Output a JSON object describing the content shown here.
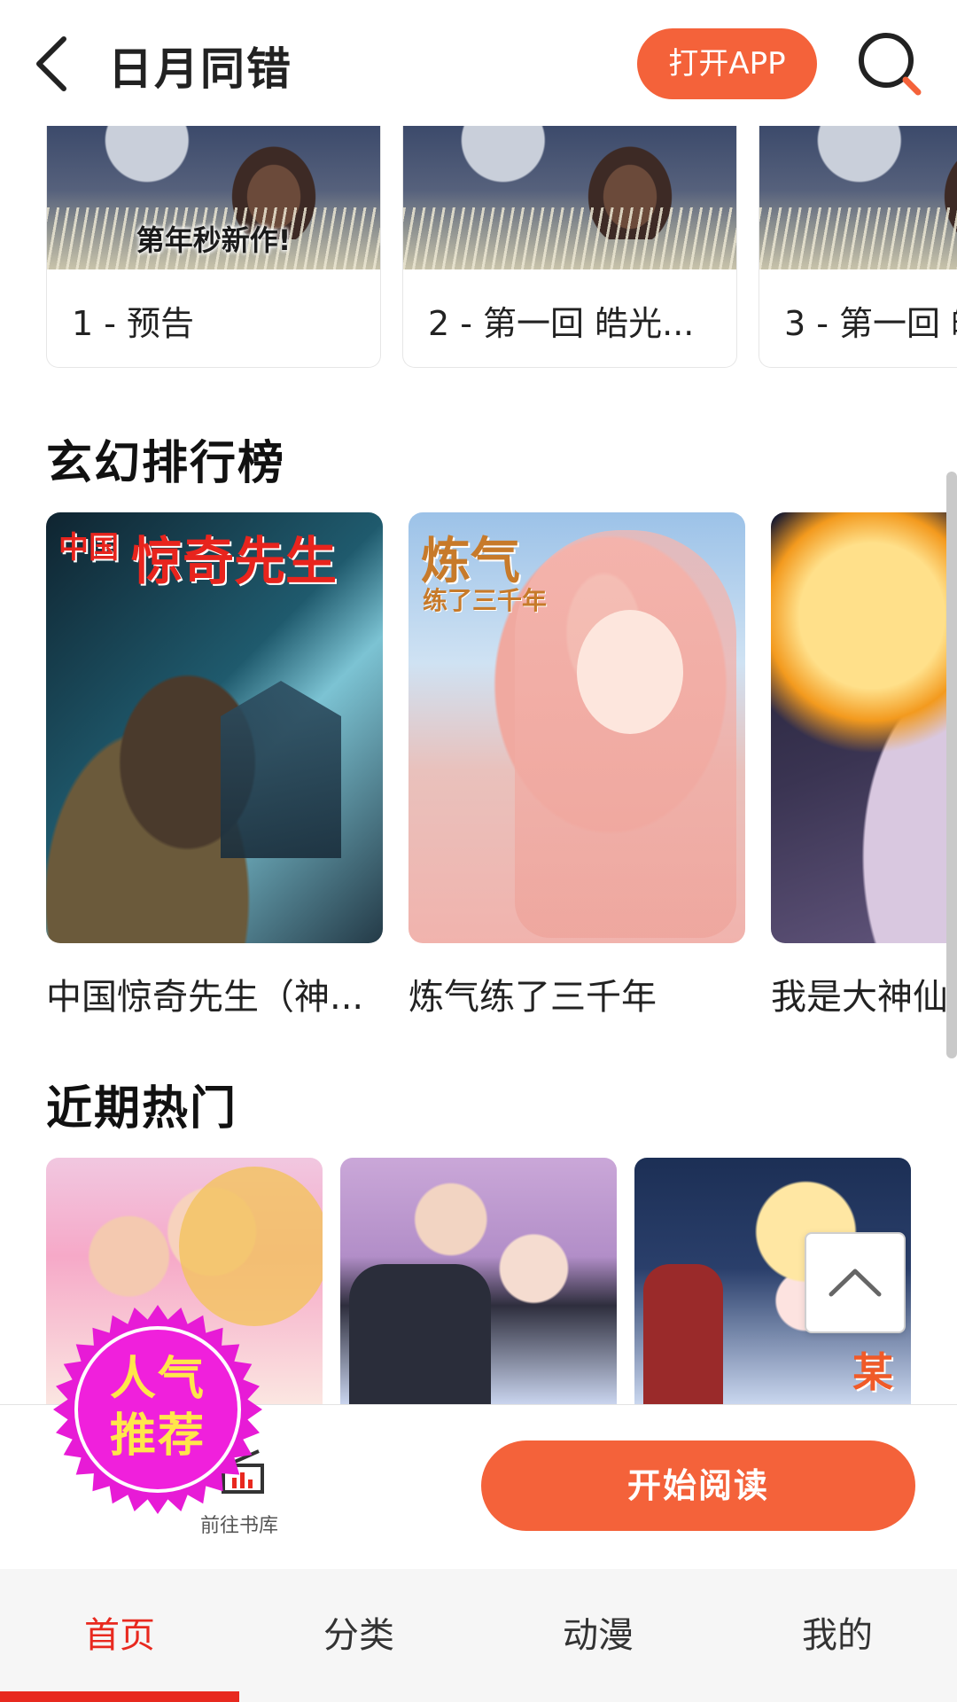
{
  "header": {
    "title": "日月同错",
    "open_app": "打开APP"
  },
  "episodes": [
    {
      "label": "1 - 预告",
      "caption": "第年秒新作!"
    },
    {
      "label": "2 - 第一回 皓光..."
    },
    {
      "label": "3 - 第一回 皓"
    }
  ],
  "ranking": {
    "title": "玄幻排行榜",
    "items": [
      {
        "name": "中国惊奇先生（神...",
        "cover_big": "惊奇先生",
        "cover_small": "中国"
      },
      {
        "name": "炼气练了三千年",
        "cover_big": "炼气",
        "cover_small": "练了三千年"
      },
      {
        "name": "我是大神仙"
      }
    ]
  },
  "hot": {
    "title": "近期热门",
    "cover3_char": "某"
  },
  "badge": {
    "line1": "人气",
    "line2": "推荐",
    "color": "#e71bd6"
  },
  "action_bar": {
    "library": "前往书库",
    "start_reading": "开始阅读"
  },
  "tabs": [
    {
      "label": "首页",
      "active": true
    },
    {
      "label": "分类"
    },
    {
      "label": "动漫"
    },
    {
      "label": "我的"
    }
  ],
  "colors": {
    "accent": "#f4623a",
    "tab_active": "#e8291f"
  },
  "icons": [
    "back-icon",
    "search-icon",
    "chevron-up-icon",
    "library-icon"
  ]
}
